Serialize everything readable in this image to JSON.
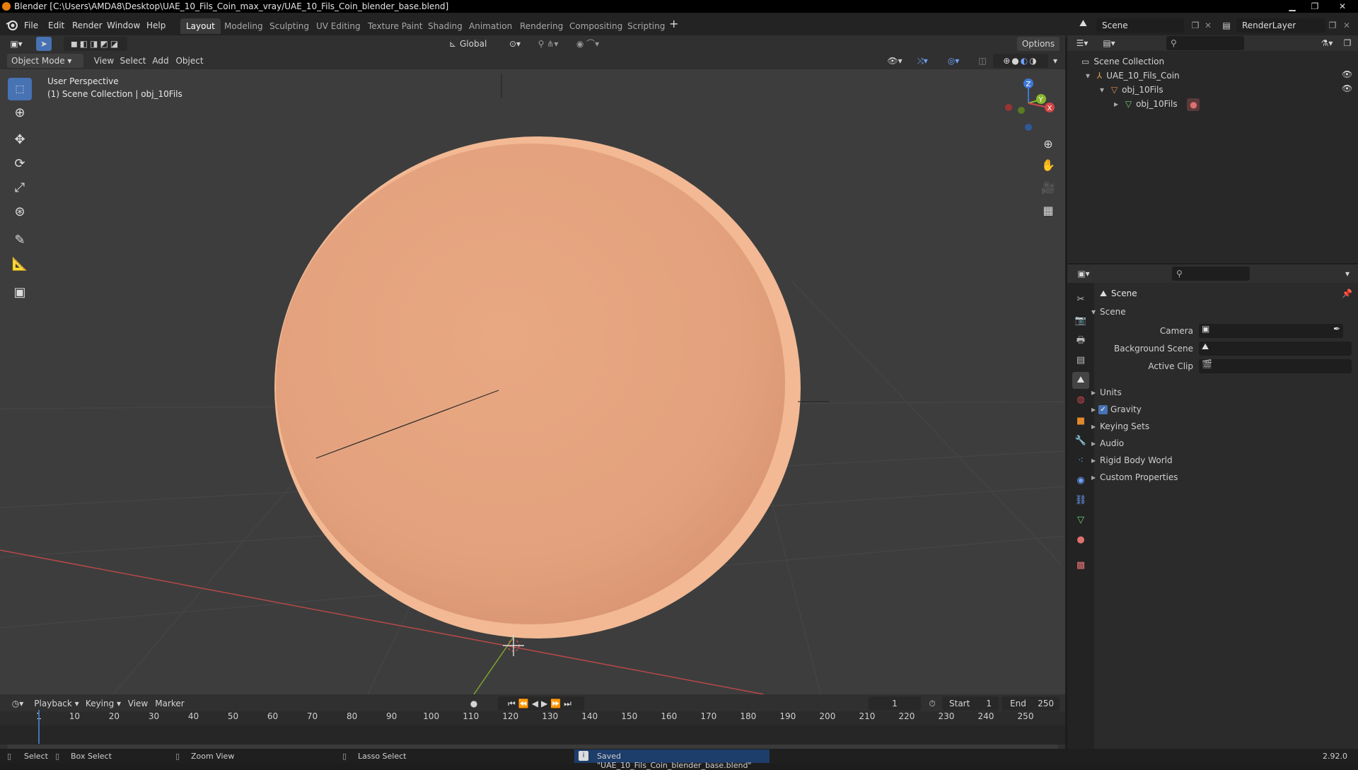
{
  "title_bar": {
    "title": "Blender [C:\\Users\\AMDA8\\Desktop\\UAE_10_Fils_Coin_max_vray/UAE_10_Fils_Coin_blender_base.blend]",
    "minimize": "▁",
    "maximize": "❐",
    "close": "✕"
  },
  "menu": {
    "items": [
      "File",
      "Edit",
      "Render",
      "Window",
      "Help"
    ],
    "workspaces": [
      "Layout",
      "Modeling",
      "Sculpting",
      "UV Editing",
      "Texture Paint",
      "Shading",
      "Animation",
      "Rendering",
      "Compositing",
      "Scripting"
    ],
    "add_workspace": "+",
    "scene_name": "Scene",
    "render_layer": "RenderLayer"
  },
  "toolbar_header": {
    "transform_orientation": "Global",
    "options_label": "Options"
  },
  "viewport_header": {
    "mode": "Object Mode",
    "menus": [
      "View",
      "Select",
      "Add",
      "Object"
    ]
  },
  "viewport": {
    "view_name": "User Perspective",
    "collection_info": "(1) Scene Collection | obj_10Fils",
    "gizmo": {
      "z": "Z",
      "y": "Y",
      "x": "X"
    }
  },
  "outliner": {
    "root": "Scene Collection",
    "items": [
      {
        "label": "UAE_10_Fils_Coin",
        "level": 1
      },
      {
        "label": "obj_10Fils",
        "level": 2
      },
      {
        "label": "obj_10Fils",
        "level": 3
      }
    ]
  },
  "properties": {
    "context_title": "Scene",
    "panel_title": "Scene",
    "fields": [
      {
        "label": "Camera"
      },
      {
        "label": "Background Scene"
      },
      {
        "label": "Active Clip"
      }
    ],
    "collapsed_panels": [
      "Units",
      "Gravity",
      "Keying Sets",
      "Audio",
      "Rigid Body World",
      "Custom Properties"
    ],
    "gravity_checked": true
  },
  "timeline": {
    "menus": [
      "Playback",
      "Keying",
      "View",
      "Marker"
    ],
    "current_frame": "1",
    "start_label": "Start",
    "start_value": "1",
    "end_label": "End",
    "end_value": "250",
    "ticks": [
      "1",
      "10",
      "20",
      "30",
      "40",
      "50",
      "60",
      "70",
      "80",
      "90",
      "100",
      "110",
      "120",
      "130",
      "140",
      "150",
      "160",
      "170",
      "180",
      "190",
      "200",
      "210",
      "220",
      "230",
      "240",
      "250"
    ]
  },
  "status_bar": {
    "select": "Select",
    "box_select": "Box Select",
    "zoom_view": "Zoom View",
    "lasso_select": "Lasso Select",
    "message": "Saved \"UAE_10_Fils_Coin_blender_base.blend\"",
    "version": "2.92.0"
  },
  "colors": {
    "accent": "#4772b3",
    "coin": "#e3a27d",
    "x_axis": "#c74444",
    "y_axis": "#7fa72a"
  }
}
